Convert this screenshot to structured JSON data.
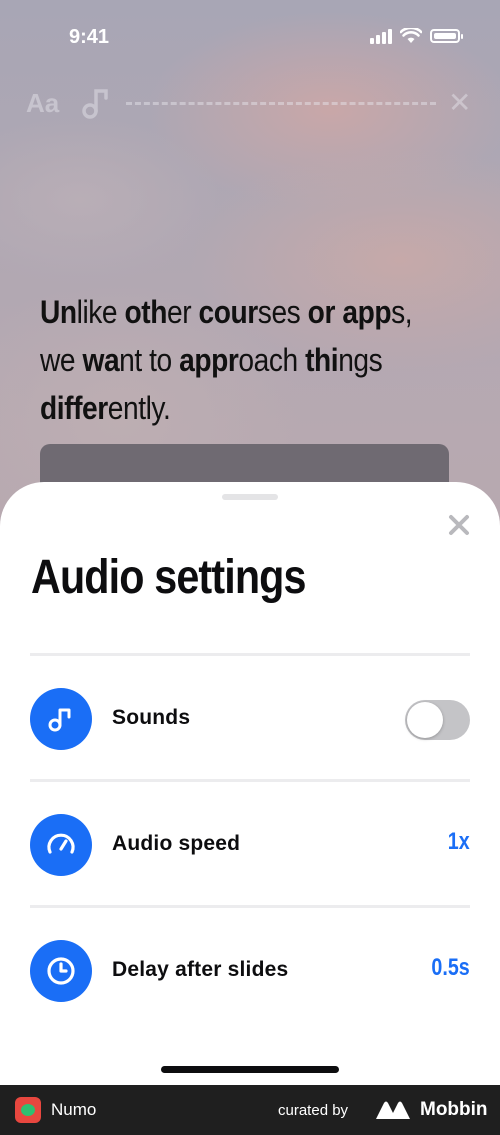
{
  "status_bar": {
    "time": "9:41"
  },
  "editor_toolbar": {
    "text_button": "Aa"
  },
  "content": {
    "headline_parts": [
      {
        "t": "Un",
        "b": true
      },
      {
        "t": "like ",
        "b": false
      },
      {
        "t": "oth",
        "b": true
      },
      {
        "t": "er ",
        "b": false
      },
      {
        "t": "cour",
        "b": true
      },
      {
        "t": "ses ",
        "b": false
      },
      {
        "t": "or ",
        "b": true
      },
      {
        "t": "app",
        "b": true
      },
      {
        "t": "s,",
        "b": false
      },
      {
        "t": "\n",
        "b": false
      },
      {
        "t": "we ",
        "b": false
      },
      {
        "t": "wa",
        "b": true
      },
      {
        "t": "nt to ",
        "b": false
      },
      {
        "t": "appr",
        "b": true
      },
      {
        "t": "oach ",
        "b": false
      },
      {
        "t": "thi",
        "b": true
      },
      {
        "t": "ngs",
        "b": false
      },
      {
        "t": "\n",
        "b": false
      },
      {
        "t": "differ",
        "b": true
      },
      {
        "t": "ently.",
        "b": false
      }
    ]
  },
  "sheet": {
    "title": "Audio settings",
    "rows": [
      {
        "label": "Sounds",
        "control": "toggle",
        "on": false,
        "icon": "music-note-icon"
      },
      {
        "label": "Audio speed",
        "value": "1x",
        "icon": "speedometer-icon"
      },
      {
        "label": "Delay after slides",
        "value": "0.5s",
        "icon": "clock-icon"
      }
    ]
  },
  "footer": {
    "app_name": "Numo",
    "curated_by": "curated by",
    "brand": "Mobbin"
  },
  "colors": {
    "accent": "#1a6ef6",
    "toggle_off": "#c4c4c7",
    "footer_bg": "#1f1f1f"
  }
}
